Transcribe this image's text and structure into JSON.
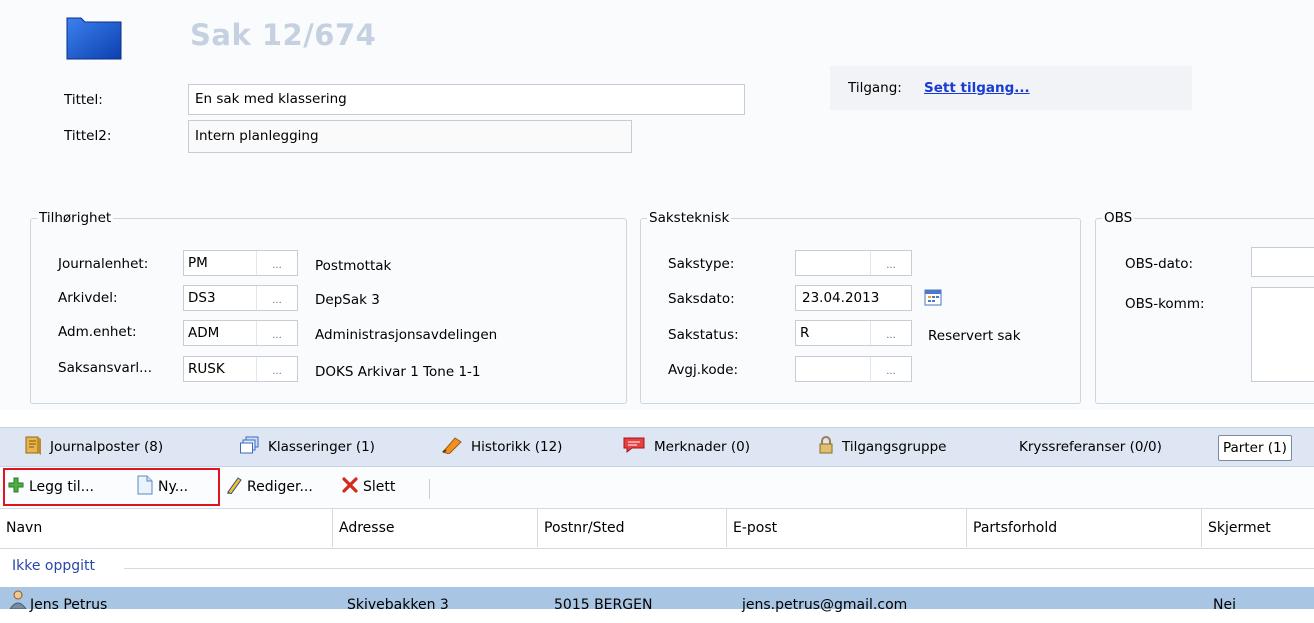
{
  "case": {
    "title": "Sak 12/674"
  },
  "fields": {
    "tittel_label": "Tittel:",
    "tittel_value": "En sak med klassering",
    "tittel2_label": "Tittel2:",
    "tittel2_value": "Intern planlegging",
    "tilgang_label": "Tilgang:",
    "tilgang_link": "Sett tilgang..."
  },
  "tilhorighet": {
    "legend": "Tilhørighet",
    "rows": [
      {
        "label": "Journalenhet:",
        "code": "PM",
        "desc": "Postmottak"
      },
      {
        "label": "Arkivdel:",
        "code": "DS3",
        "desc": "DepSak 3"
      },
      {
        "label": "Adm.enhet:",
        "code": "ADM",
        "desc": "Administrasjonsavdelingen"
      },
      {
        "label": "Saksansvarl...",
        "code": "RUSK",
        "desc": "DOKS Arkivar 1 Tone 1-1"
      }
    ]
  },
  "saksteknisk": {
    "legend": "Saksteknisk",
    "sakstype_label": "Sakstype:",
    "sakstype_value": "",
    "saksdato_label": "Saksdato:",
    "saksdato_value": "23.04.2013",
    "sakstatus_label": "Sakstatus:",
    "sakstatus_value": "R",
    "sakstatus_desc": "Reservert sak",
    "avgj_label": "Avgj.kode:",
    "avgj_value": ""
  },
  "obs": {
    "legend": "OBS",
    "dato_label": "OBS-dato:",
    "komm_label": "OBS-komm:"
  },
  "ellipsis": "...",
  "tabs": [
    {
      "label": "Journalposter (8)",
      "icon": "journal-icon"
    },
    {
      "label": "Klasseringer (1)",
      "icon": "klassering-icon"
    },
    {
      "label": "Historikk (12)",
      "icon": "historikk-icon"
    },
    {
      "label": "Merknader (0)",
      "icon": "merknad-icon"
    },
    {
      "label": "Tilgangsgruppe",
      "icon": "lock-icon"
    },
    {
      "label": "Kryssreferanser (0/0)",
      "icon": ""
    },
    {
      "label": "Parter (1)",
      "icon": ""
    }
  ],
  "toolbar": {
    "add_label": "Legg til...",
    "new_label": "Ny...",
    "edit_label": "Rediger...",
    "delete_label": "Slett"
  },
  "columns": [
    "Navn",
    "Adresse",
    "Postnr/Sted",
    "E-post",
    "Partsforhold",
    "Skjermet"
  ],
  "group_label": "Ikke oppgitt",
  "rows": [
    {
      "navn": "Jens Petrus",
      "adresse": "Skivebakken 3",
      "postnr": "5015 BERGEN",
      "epost": "jens.petrus@gmail.com",
      "partsforhold": "",
      "skjermet": "Nei"
    }
  ],
  "colors": {
    "highlight_box": "#e0141e",
    "selected_row": "#a8c5e4",
    "link": "#1a3cd0",
    "tabbar": "#dde6f2"
  }
}
